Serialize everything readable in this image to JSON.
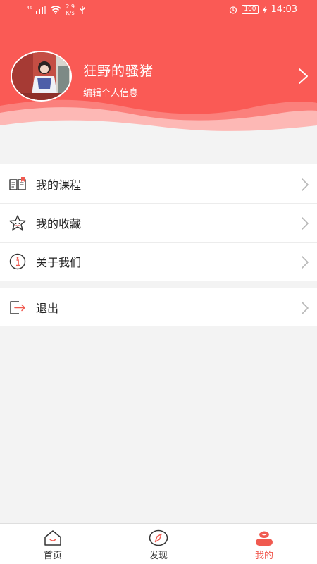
{
  "status_bar": {
    "signal_badge": "⁴⁶",
    "speed_value": "2.9",
    "speed_unit": "K/s",
    "battery": "100",
    "time": "14:03"
  },
  "profile": {
    "username": "狂野的骚猪",
    "edit_label": "编辑个人信息"
  },
  "menu": {
    "items": [
      {
        "label": "我的课程",
        "icon": "book-icon"
      },
      {
        "label": "我的收藏",
        "icon": "star-icon"
      },
      {
        "label": "关于我们",
        "icon": "info-icon"
      }
    ],
    "logout": {
      "label": "退出",
      "icon": "logout-icon"
    }
  },
  "bottom_nav": {
    "items": [
      {
        "label": "首页",
        "icon": "home-icon"
      },
      {
        "label": "发现",
        "icon": "compass-icon"
      },
      {
        "label": "我的",
        "icon": "person-icon"
      }
    ],
    "active_index": 2
  },
  "colors": {
    "header": "#fa5a55",
    "accent": "#f05a50",
    "background": "#f3f3f3"
  }
}
